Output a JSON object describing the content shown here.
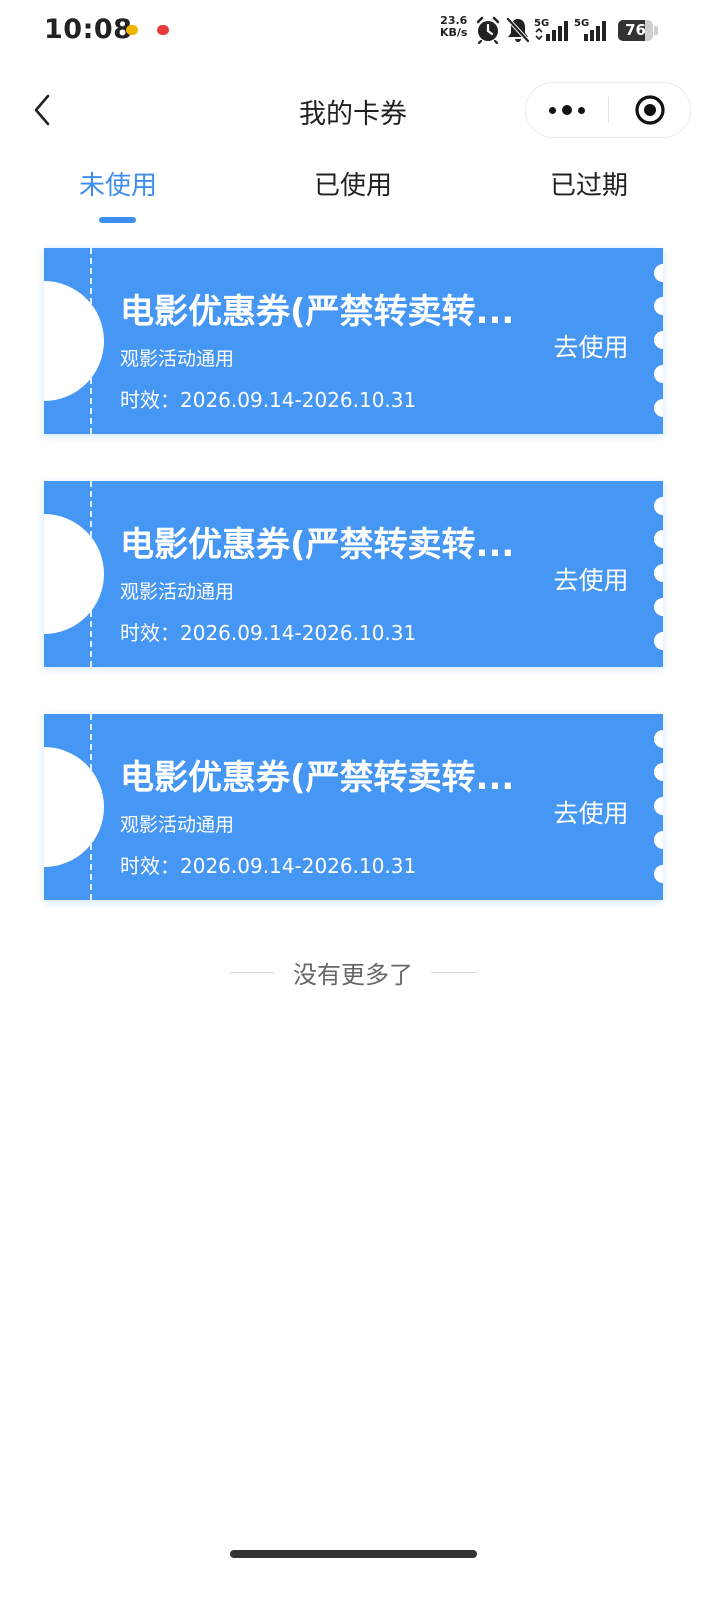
{
  "status_bar": {
    "time": "10:08",
    "net_speed_value": "23.6",
    "net_speed_unit": "KB/s",
    "sim1_label": "5G",
    "sim2_label": "5G",
    "battery": "76",
    "battery_level": 0.76,
    "notification_icons": [
      "app-notification-icon",
      "app-notification-icon"
    ]
  },
  "nav": {
    "title": "我的卡券",
    "back_icon": "chevron-left-icon",
    "more_icon": "more-dots-icon",
    "close_icon": "target-circle-icon"
  },
  "tabs": [
    {
      "label": "未使用",
      "active": true
    },
    {
      "label": "已使用",
      "active": false
    },
    {
      "label": "已过期",
      "active": false
    }
  ],
  "coupons": [
    {
      "title": "电影优惠券(严禁转卖转...",
      "desc": "观影活动通用",
      "valid": "时效：2026.09.14-2026.10.31",
      "action": "去使用"
    },
    {
      "title": "电影优惠券(严禁转卖转...",
      "desc": "观影活动通用",
      "valid": "时效：2026.09.14-2026.10.31",
      "action": "去使用"
    },
    {
      "title": "电影优惠券(严禁转卖转...",
      "desc": "观影活动通用",
      "valid": "时效：2026.09.14-2026.10.31",
      "action": "去使用"
    }
  ],
  "footer": {
    "no_more": "没有更多了"
  },
  "colors": {
    "accent": "#3c8ef0",
    "coupon_bg": "#4696f3"
  }
}
